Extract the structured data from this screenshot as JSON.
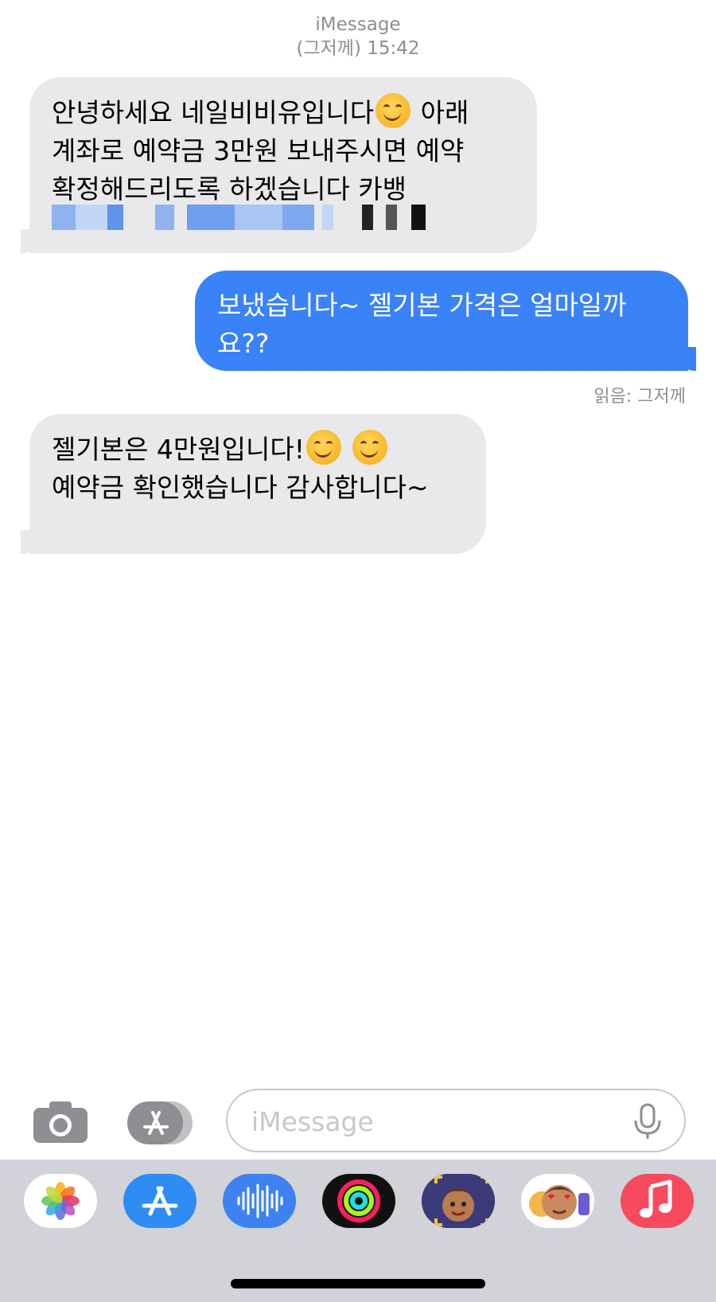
{
  "header": {
    "service": "iMessage",
    "timestamp": "(그저께) 15:42"
  },
  "messages": [
    {
      "side": "in",
      "lines": [
        "안녕하세요 네일비비유입니다",
        "아래",
        "계좌로 예약금 3만원 보내주시면 예약",
        "확정해드리도록 하겠습니다 카뱅"
      ]
    },
    {
      "side": "out",
      "lines": [
        "보냈습니다~ 젤기본 가격은 얼마일까",
        "요??"
      ]
    },
    {
      "side": "in",
      "lines": [
        "젤기본은 4만원입니다!",
        "예약금 확인했습니다 감사합니다~"
      ]
    }
  ],
  "read_receipt": "읽음: 그저께",
  "input": {
    "placeholder": "iMessage"
  },
  "icons": {
    "camera": "camera-icon",
    "appstore": "appstore-icon",
    "mic": "microphone-icon",
    "emoji": "smiling-face-emoji"
  },
  "dock_apps": [
    "photos-icon",
    "appstore-icon",
    "audio-message-icon",
    "activity-icon",
    "memoji-camera-icon",
    "memoji-stickers-icon",
    "music-icon"
  ],
  "colors": {
    "outgoing_bubble": "#3a82f7",
    "incoming_bubble": "#e9e9eb"
  }
}
